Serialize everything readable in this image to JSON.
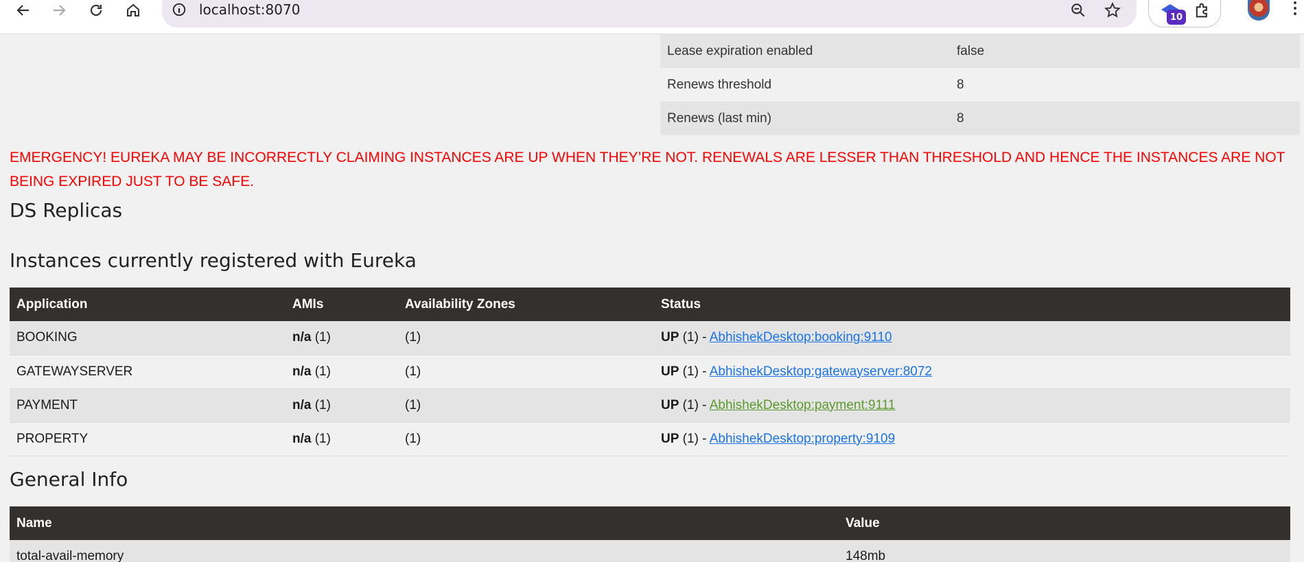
{
  "browser": {
    "url": "localhost:8070",
    "extension_badge": "10"
  },
  "lease_info": [
    {
      "key": "Lease expiration enabled",
      "value": "false"
    },
    {
      "key": "Renews threshold",
      "value": "8"
    },
    {
      "key": "Renews (last min)",
      "value": "8"
    }
  ],
  "emergency_message": "EMERGENCY! EUREKA MAY BE INCORRECTLY CLAIMING INSTANCES ARE UP WHEN THEY’RE NOT. RENEWALS ARE LESSER THAN THRESHOLD AND HENCE THE INSTANCES ARE NOT BEING EXPIRED JUST TO BE SAFE.",
  "ds_replicas_title": "DS Replicas",
  "instances": {
    "title": "Instances currently registered with Eureka",
    "columns": [
      "Application",
      "AMIs",
      "Availability Zones",
      "Status"
    ],
    "rows": [
      {
        "application": "BOOKING",
        "ami": "n/a",
        "ami_count": " (1)",
        "zones": "(1)",
        "status": "UP",
        "status_count": " (1) - ",
        "link": "AbhishekDesktop:booking:9110"
      },
      {
        "application": "GATEWAYSERVER",
        "ami": "n/a",
        "ami_count": " (1)",
        "zones": "(1)",
        "status": "UP",
        "status_count": " (1) - ",
        "link": "AbhishekDesktop:gatewayserver:8072"
      },
      {
        "application": "PAYMENT",
        "ami": "n/a",
        "ami_count": " (1)",
        "zones": "(1)",
        "status": "UP",
        "status_count": " (1) - ",
        "link": "AbhishekDesktop:payment:9111"
      },
      {
        "application": "PROPERTY",
        "ami": "n/a",
        "ami_count": " (1)",
        "zones": "(1)",
        "status": "UP",
        "status_count": " (1) - ",
        "link": "AbhishekDesktop:property:9109"
      }
    ]
  },
  "general_info": {
    "title": "General Info",
    "columns": [
      "Name",
      "Value"
    ],
    "rows": [
      {
        "name": "total-avail-memory",
        "value": "148mb"
      }
    ]
  },
  "colors": {
    "header_bg": "#34302d",
    "emergency": "#ff0000",
    "link": "#1a73e8",
    "visited_link": "#5a9a2a"
  }
}
